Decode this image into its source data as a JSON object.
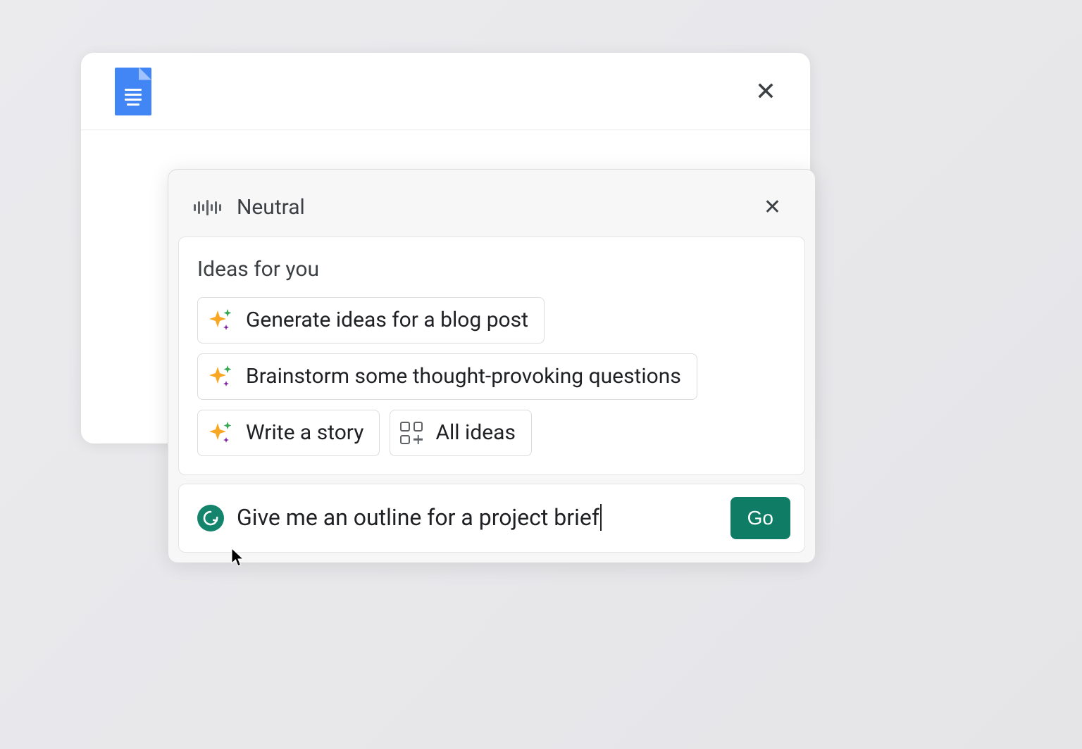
{
  "doc_window": {
    "close_label": "✕"
  },
  "assist": {
    "tone_label": "Neutral",
    "close_label": "✕",
    "ideas_title": "Ideas for you",
    "chips": [
      {
        "label": "Generate ideas for a blog post"
      },
      {
        "label": "Brainstorm some thought-provoking questions"
      },
      {
        "label": "Write a story"
      },
      {
        "label": "All ideas"
      }
    ],
    "prompt_text": "Give me an outline for a project brief",
    "go_label": "Go"
  }
}
